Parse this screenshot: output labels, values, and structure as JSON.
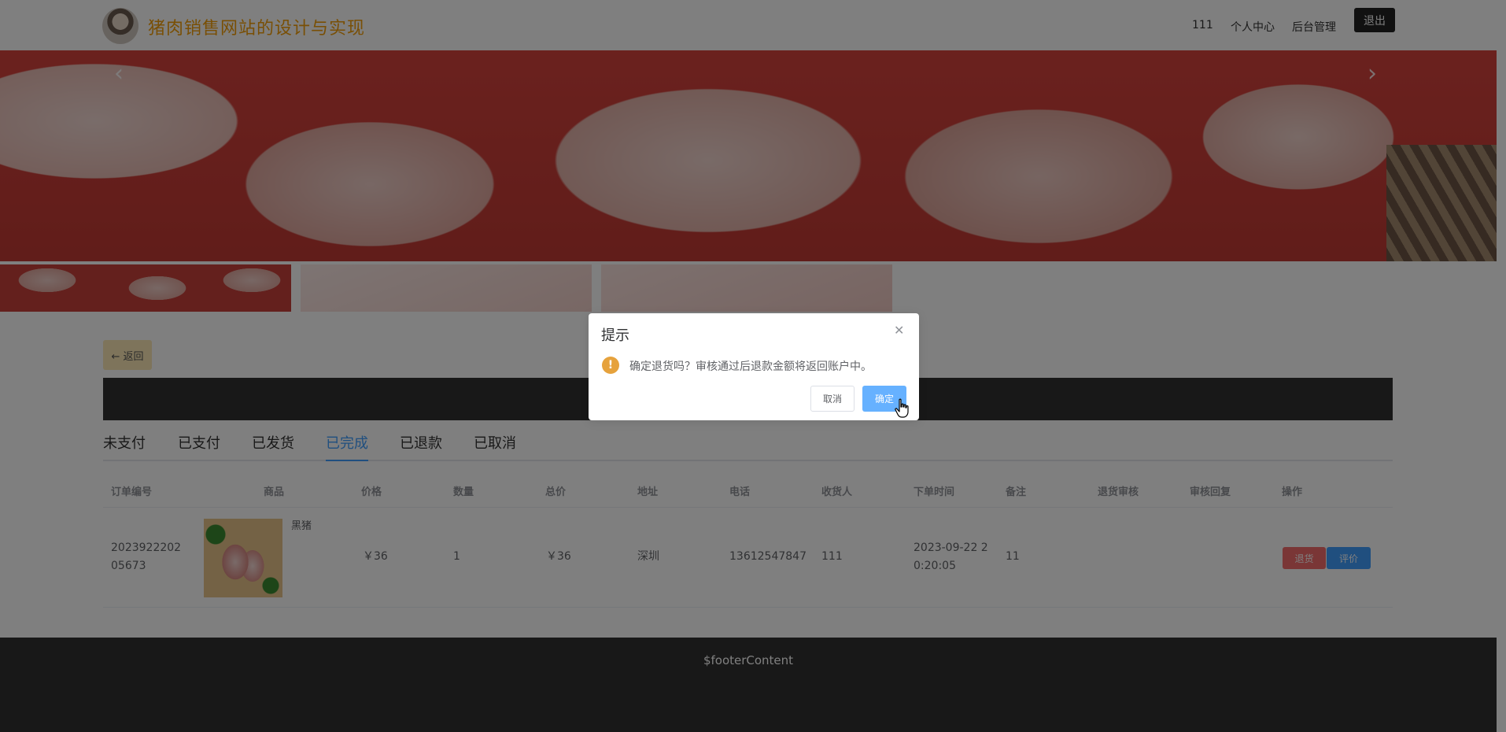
{
  "header": {
    "site_title": "猪肉销售网站的设计与实现",
    "nav": {
      "username": "111",
      "personal_center": "个人中心",
      "admin": "后台管理",
      "logout": "退出"
    }
  },
  "carousel": {
    "prev_icon": "chevron-left-icon",
    "next_icon": "chevron-right-icon"
  },
  "back_label": "← 返回",
  "tabs": [
    {
      "label": "未支付",
      "active": false
    },
    {
      "label": "已支付",
      "active": false
    },
    {
      "label": "已发货",
      "active": false
    },
    {
      "label": "已完成",
      "active": true
    },
    {
      "label": "已退款",
      "active": false
    },
    {
      "label": "已取消",
      "active": false
    }
  ],
  "table": {
    "headers": [
      "订单编号",
      "商品",
      "价格",
      "数量",
      "总价",
      "地址",
      "电话",
      "收货人",
      "下单时间",
      "备注",
      "退货审核",
      "审核回复",
      "操作"
    ],
    "rows": [
      {
        "order_no": "202392220205673",
        "product_name": "黑猪",
        "price": "￥36",
        "quantity": "1",
        "total": "￥36",
        "address": "深圳",
        "phone": "13612547847",
        "receiver": "111",
        "order_time": "2023-09-22 20:20:05",
        "remark": "11",
        "return_review": "",
        "review_reply": "",
        "actions": {
          "refund": "退货",
          "review": "评价"
        }
      }
    ]
  },
  "footer": {
    "content": "$footerContent"
  },
  "dialog": {
    "title": "提示",
    "message": "确定退货吗？审核通过后退款金额将返回账户中。",
    "cancel": "取消",
    "confirm": "确定",
    "warn_icon_text": "!"
  },
  "colors": {
    "brand_title": "#f29f0b",
    "primary": "#409eff",
    "danger": "#f56c6c",
    "warning": "#e6a23c"
  }
}
